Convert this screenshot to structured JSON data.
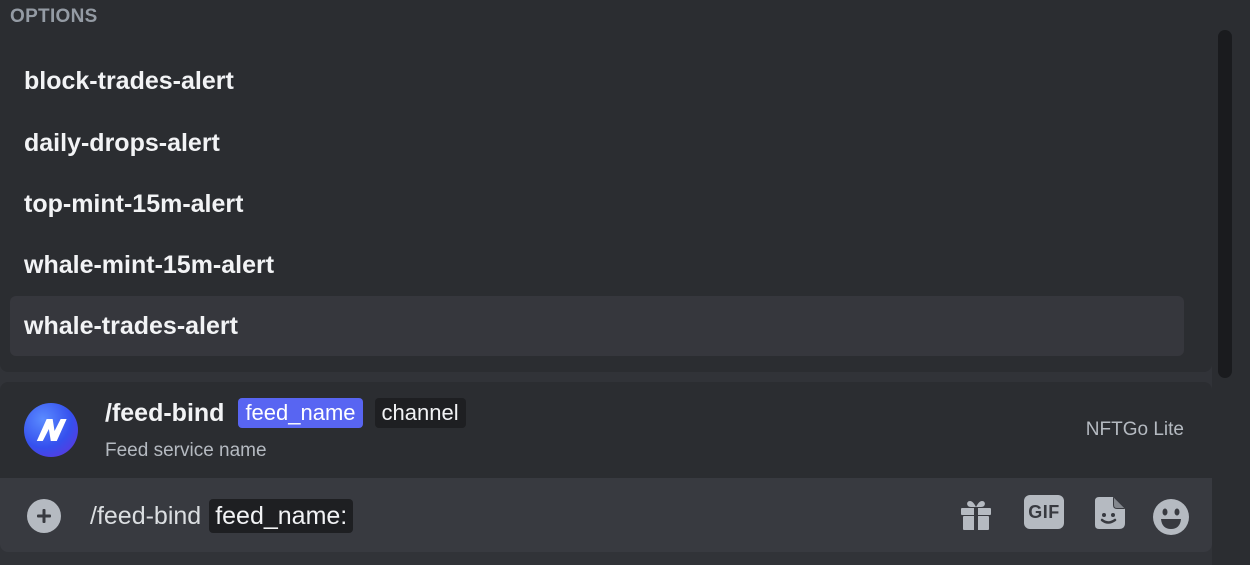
{
  "options": {
    "header": "OPTIONS",
    "items": [
      {
        "label": "block-trades-alert"
      },
      {
        "label": "daily-drops-alert"
      },
      {
        "label": "top-mint-15m-alert"
      },
      {
        "label": "whale-mint-15m-alert"
      },
      {
        "label": "whale-trades-alert",
        "selected": true
      }
    ]
  },
  "command": {
    "name": "/feed-bind",
    "params": [
      "feed_name",
      "channel"
    ],
    "active_param": "feed_name",
    "description": "Feed service name",
    "bot_name": "NFTGo Lite"
  },
  "composer": {
    "command_text": "/feed-bind",
    "option_chip": "feed_name:",
    "icons": [
      "add-icon",
      "gift-icon",
      "gif-icon",
      "sticker-icon",
      "emoji-icon"
    ],
    "gif_label": "GIF"
  },
  "colors": {
    "accent": "#5865f2",
    "background": "#313338",
    "panel": "#2b2d31",
    "composer": "#383a40"
  }
}
